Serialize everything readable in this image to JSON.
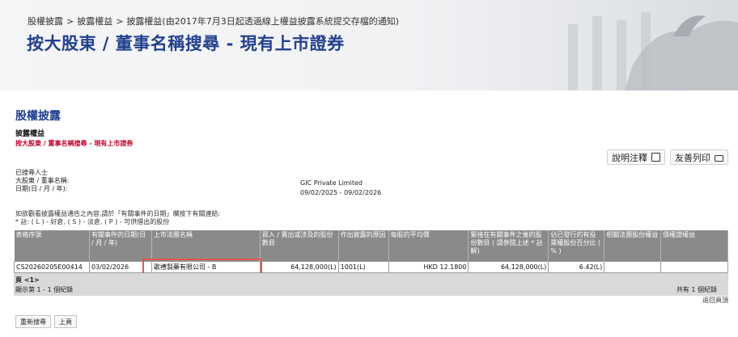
{
  "breadcrumb": {
    "item1": "股權披露",
    "sep": ">",
    "item2": "披露權益",
    "item3": "披露權益(由2017年7月3日起透過線上權益披露系統提交存檔的通知)"
  },
  "page_title": "按大股東 / 董事名稱搜尋 - 現有上市證券",
  "section_title": "股權披露",
  "sub_title": "披露權益",
  "sub_link": "按大股東 / 董事名稱搜尋 - 現有上市證券",
  "toolbar": {
    "notes_label": "說明注釋",
    "print_label": "友善列印"
  },
  "search_info": {
    "searcher_label": "已搜尋人士",
    "name_label": "大股東 / 董事名稱:",
    "name_value": "GIC Private Limited",
    "date_label": "日期(日 / 月 / 年):",
    "date_value": "09/02/2025 - 09/02/2026"
  },
  "note": {
    "line1": "如欲觀看披露權益通告之內容,請於「有關事件的日期」欄按下有關連結:",
    "line2": "* 註: ( L ) - 好倉, ( S ) - 淡倉, ( P ) - 可供借出的股份"
  },
  "table": {
    "headers": [
      "表格序號",
      "有關事件的日期(日 / 月 / 年)",
      "上市法團名稱",
      "買入 / 賣出或涉及的股份數目",
      "作出披露的原因",
      "每股的平均價",
      "緊接在有關事件之後的股份數目 ( 請參閱上述 * 註解)",
      "佔已發行的有投票權股份百分比 ( % )",
      "相關法團股份權益",
      "債權證權益"
    ],
    "rows": [
      {
        "form_no": "CS20260205E00414",
        "event_date": "03/02/2026",
        "company": "歌禮製藥有限公司 - B",
        "shares_involved": "64,128,000(L)",
        "reason": "1001(L)",
        "avg_price": "HKD 12.1800",
        "shares_after": "64,128,000(L)",
        "pct": "6.42(L)",
        "assoc_interest": "",
        "debenture": ""
      }
    ]
  },
  "paging": {
    "page": "頁 <1>",
    "showing": "顯示第 1 - 1 個紀錄",
    "total": "共有 1 個紀錄",
    "back_top": "返回頁頂"
  },
  "buttons": {
    "new_search": "重新搜尋",
    "prev": "上頁"
  },
  "colors": {
    "title_blue": "#23408e",
    "link_red": "#c0002a",
    "header_gray": "#8a8a8a",
    "highlight": "#e8554f"
  }
}
